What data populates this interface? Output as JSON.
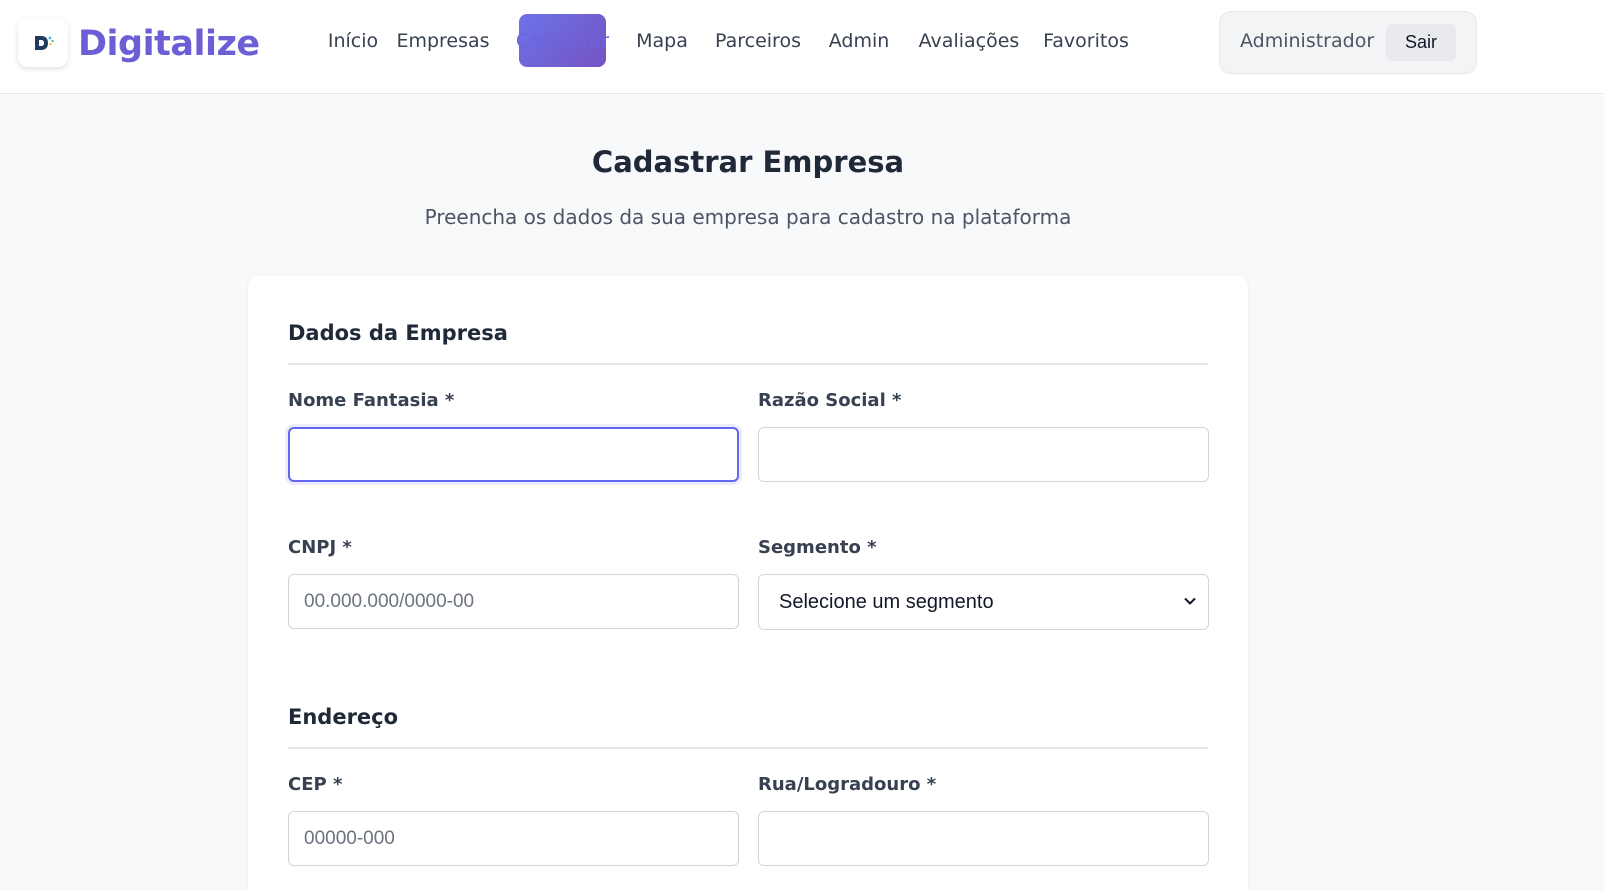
{
  "header": {
    "brand": "Digitalize",
    "nav": [
      "Início",
      "Empresas",
      "Cadastrar",
      "Mapa",
      "Parceiros",
      "Admin",
      "Avaliações",
      "Favoritos"
    ],
    "active_nav": "Cadastrar",
    "user_name": "Administrador",
    "logout_label": "Sair"
  },
  "page": {
    "title": "Cadastrar Empresa",
    "subtitle": "Preencha os dados da sua empresa para cadastro na plataforma"
  },
  "form": {
    "company_section": {
      "title": "Dados da Empresa",
      "trade_name": {
        "label": "Nome Fantasia *",
        "value": ""
      },
      "legal_name": {
        "label": "Razão Social *",
        "value": ""
      },
      "cnpj": {
        "label": "CNPJ *",
        "placeholder": "00.000.000/0000-00",
        "value": ""
      },
      "segment": {
        "label": "Segmento *",
        "selected": "Selecione um segmento"
      }
    },
    "address_section": {
      "title": "Endereço",
      "cep": {
        "label": "CEP *",
        "placeholder": "00000-000",
        "value": ""
      },
      "street": {
        "label": "Rua/Logradouro *",
        "value": ""
      }
    }
  },
  "icons": {
    "logo": "digitalize-logo-icon",
    "select_arrow": "chevron-down-icon"
  },
  "colors": {
    "brand": "#6c5ed4",
    "active_nav_start": "#6b73e8",
    "active_nav_end": "#7653c2",
    "focus_border": "#6366f1"
  }
}
